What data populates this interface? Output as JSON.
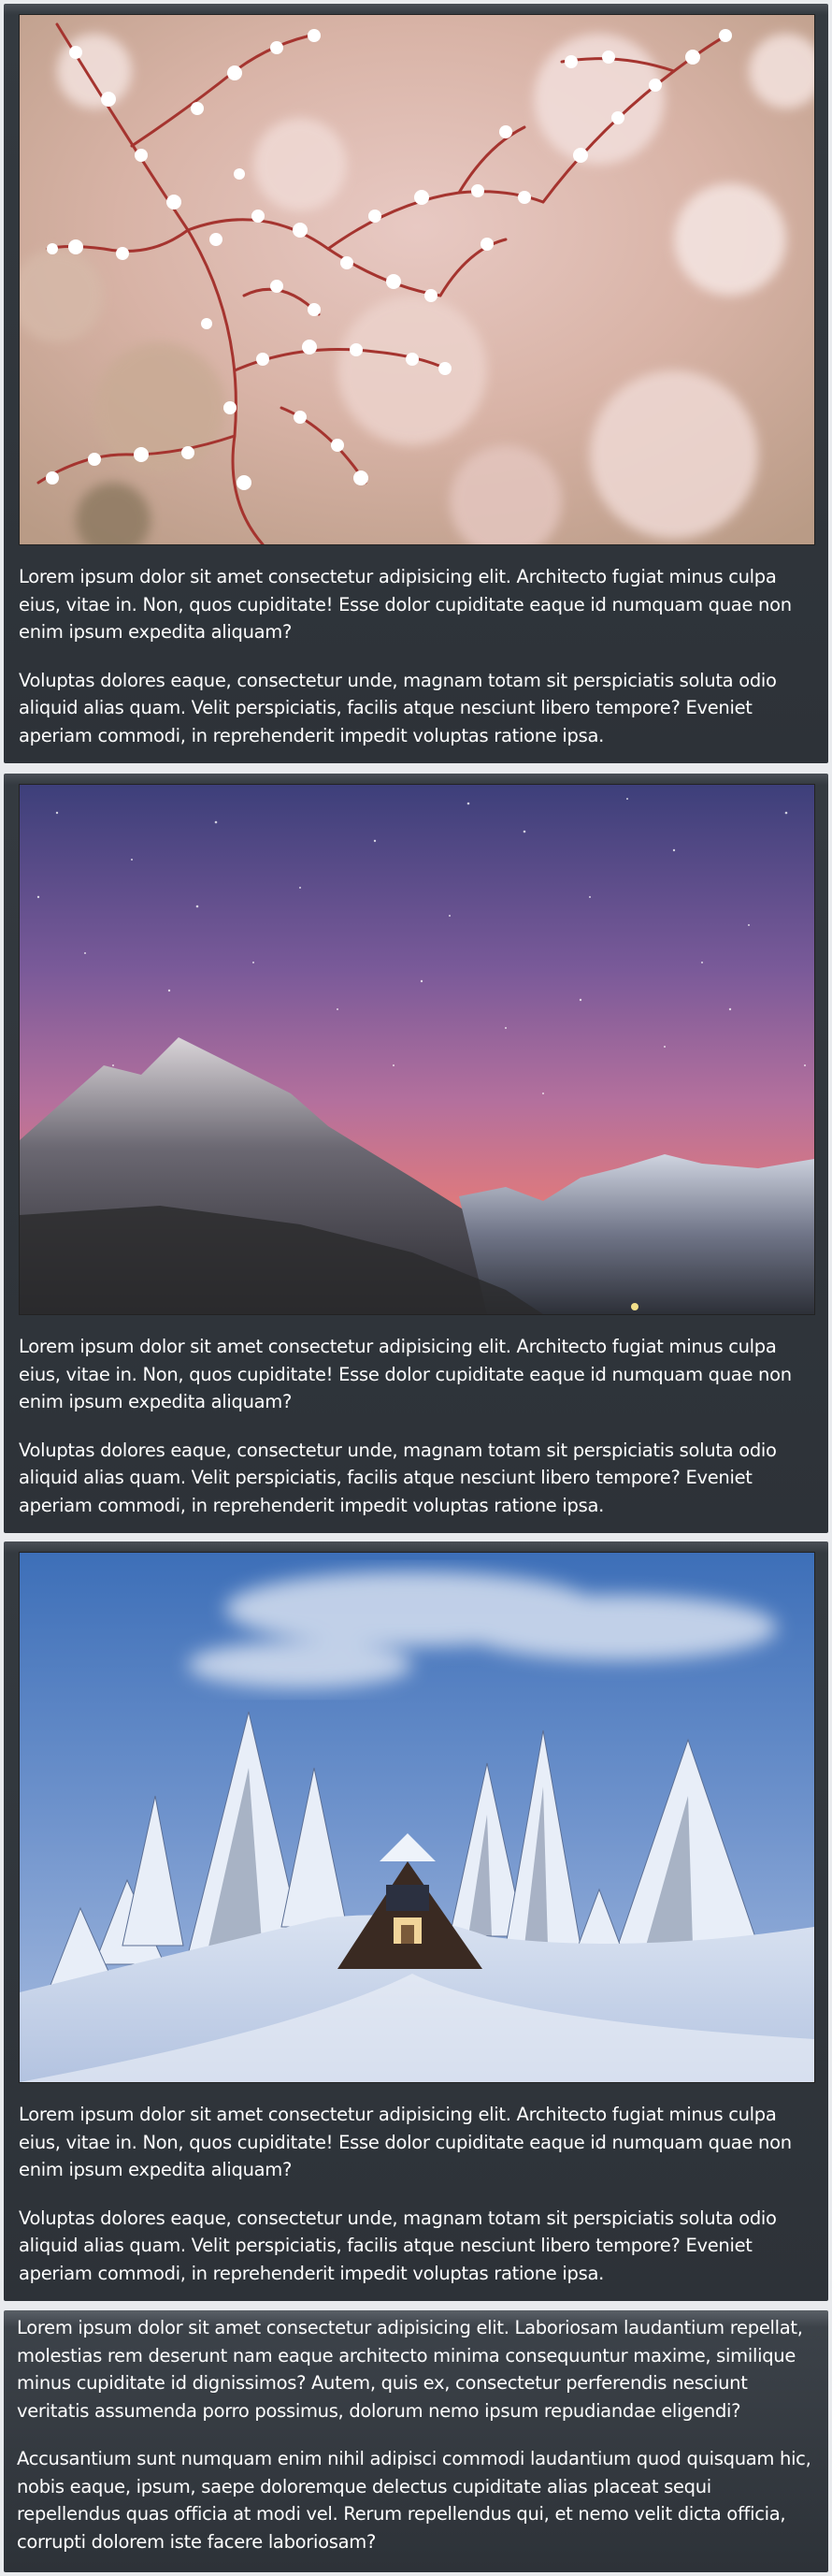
{
  "cards": [
    {
      "image": "cherry-blossom-branches-photo",
      "paragraphs": [
        "Lorem ipsum dolor sit amet consectetur adipisicing elit. Architecto fugiat minus culpa eius, vitae in. Non, quos cupiditate! Esse dolor cupiditate eaque id numquam quae non enim ipsum expedita aliquam?",
        "Voluptas dolores eaque, consectetur unde, magnam totam sit perspiciatis soluta odio aliquid alias quam. Velit perspiciatis, facilis atque nesciunt libero tempore? Eveniet aperiam commodi, in reprehenderit impedit voluptas ratione ipsa."
      ]
    },
    {
      "image": "mountains-starry-sunset-photo",
      "paragraphs": [
        "Lorem ipsum dolor sit amet consectetur adipisicing elit. Architecto fugiat minus culpa eius, vitae in. Non, quos cupiditate! Esse dolor cupiditate eaque id numquam quae non enim ipsum expedita aliquam?",
        "Voluptas dolores eaque, consectetur unde, magnam totam sit perspiciatis soluta odio aliquid alias quam. Velit perspiciatis, facilis atque nesciunt libero tempore? Eveniet aperiam commodi, in reprehenderit impedit voluptas ratione ipsa."
      ]
    },
    {
      "image": "snowy-cabin-pine-trees-photo",
      "paragraphs": [
        "Lorem ipsum dolor sit amet consectetur adipisicing elit. Architecto fugiat minus culpa eius, vitae in. Non, quos cupiditate! Esse dolor cupiditate eaque id numquam quae non enim ipsum expedita aliquam?",
        "Voluptas dolores eaque, consectetur unde, magnam totam sit perspiciatis soluta odio aliquid alias quam. Velit perspiciatis, facilis atque nesciunt libero tempore? Eveniet aperiam commodi, in reprehenderit impedit voluptas ratione ipsa."
      ]
    }
  ],
  "text_card": {
    "paragraphs": [
      "Lorem ipsum dolor sit amet consectetur adipisicing elit. Laboriosam laudantium repellat, molestias rem deserunt nam eaque architecto minima consequuntur maxime, similique minus cupiditate id dignissimos? Autem, quis ex, consectetur perferendis nesciunt veritatis assumenda porro possimus, dolorum nemo ipsum repudiandae eligendi?",
      "Accusantium sunt numquam enim nihil adipisci commodi laudantium quod quisquam hic, nobis eaque, ipsum, saepe doloremque delectus cupiditate alias placeat sequi repellendus quas officia at modi vel. Rerum repellendus qui, et nemo velit dicta officia, corrupti dolorem iste facere laboriosam?"
    ]
  },
  "colors": {
    "card_background": "#343a40",
    "page_background": "#e9ebee",
    "text": "#ffffff"
  }
}
